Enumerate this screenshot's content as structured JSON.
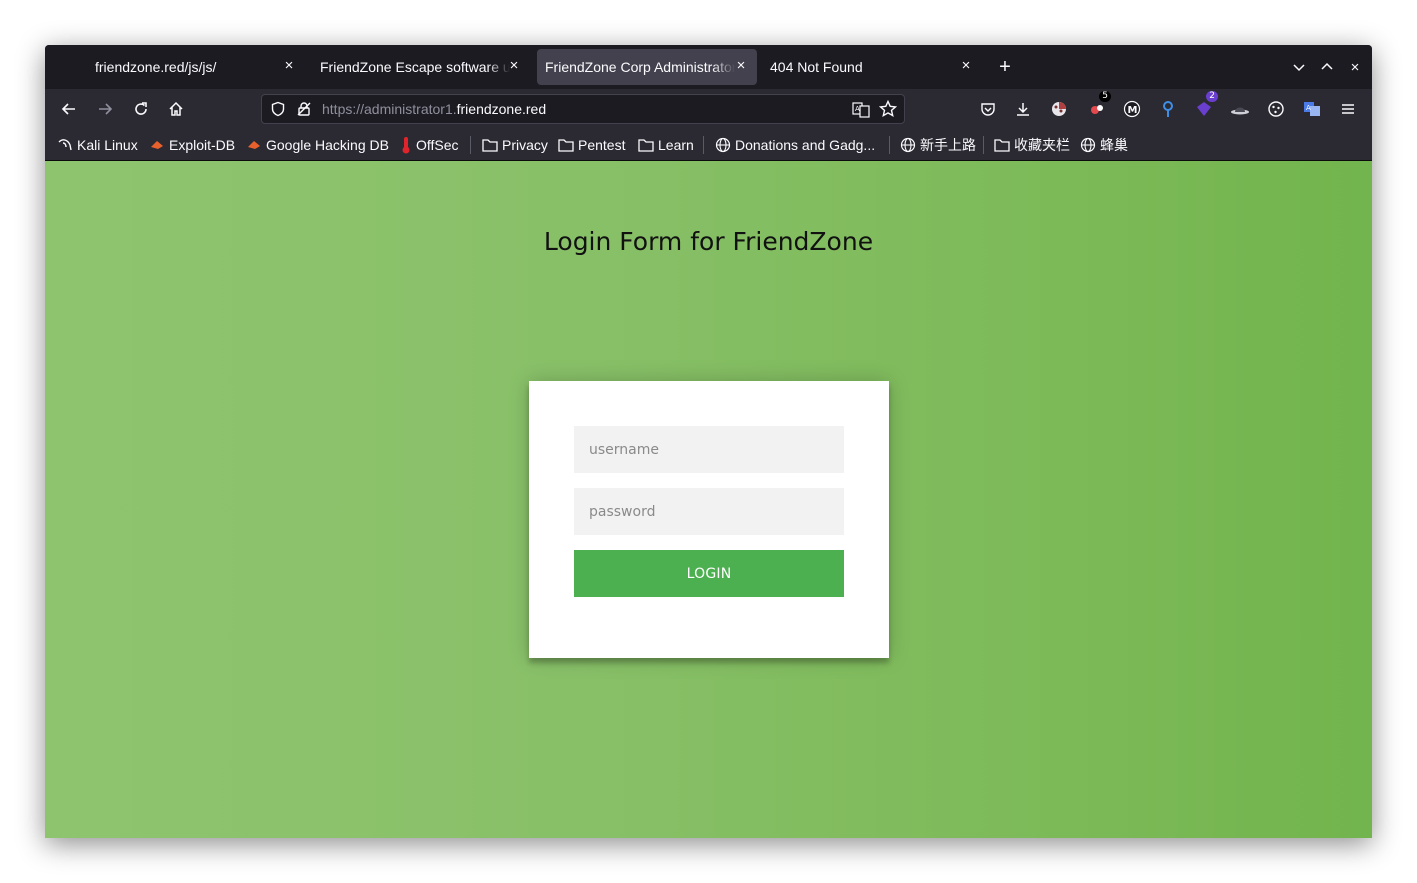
{
  "browser": {
    "tabs": [
      {
        "label": "friendzone.red/js/js/",
        "selected": false
      },
      {
        "label": "FriendZone Escape software upload",
        "selected": false
      },
      {
        "label": "FriendZone Corp Administrator Page",
        "selected": true
      },
      {
        "label": "404 Not Found",
        "selected": false
      }
    ],
    "new_tab_symbol": "+",
    "close_symbol": "×",
    "url": {
      "prefix": "https://administrator1.",
      "host": "friendzone.red"
    },
    "extensions": [
      {
        "name": "pocket-icon"
      },
      {
        "name": "download-icon"
      },
      {
        "name": "cookie-extension-icon",
        "badge": ""
      },
      {
        "name": "extension-badge-icon",
        "badge": "5"
      },
      {
        "name": "metamask-icon"
      },
      {
        "name": "location-pin-icon"
      },
      {
        "name": "purple-extension-icon",
        "badge": "2"
      },
      {
        "name": "hat-icon"
      },
      {
        "name": "cookie-icon"
      },
      {
        "name": "translate-extension-icon"
      },
      {
        "name": "menu-icon"
      }
    ],
    "bookmarks": [
      {
        "label": "Kali Linux",
        "icon": "kali-dragon-icon"
      },
      {
        "label": "Exploit-DB",
        "icon": "exploit-db-icon"
      },
      {
        "label": "Google Hacking DB",
        "icon": "ghdb-icon"
      },
      {
        "label": "OffSec",
        "icon": "offsec-icon"
      },
      {
        "label": "Privacy",
        "icon": "folder-icon"
      },
      {
        "label": "Pentest",
        "icon": "folder-icon"
      },
      {
        "label": "Learn",
        "icon": "folder-icon"
      },
      {
        "label": "Donations and Gadg...",
        "icon": "globe-icon"
      },
      {
        "label": "新手上路",
        "icon": "globe-icon"
      },
      {
        "label": "收藏夹栏",
        "icon": "folder-icon"
      },
      {
        "label": "蜂巢",
        "icon": "globe-icon"
      }
    ]
  },
  "page": {
    "title": "Login Form for FriendZone",
    "username_placeholder": "username",
    "password_placeholder": "password",
    "login_label": "LOGIN",
    "colors": {
      "background_left": "#8fc46e",
      "background_right": "#72b44d",
      "button": "#4caf50"
    }
  }
}
